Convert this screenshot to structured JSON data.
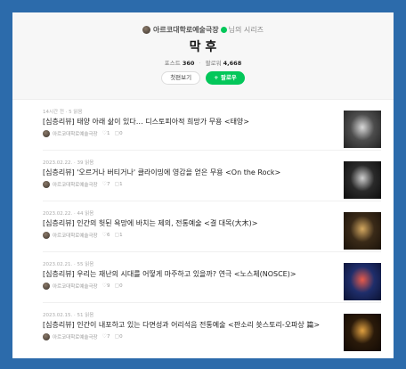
{
  "header": {
    "channel_name": "아르코대학로예술극장",
    "series_suffix": "님의 시리즈",
    "series_title": "막 후",
    "posts_label": "포스트",
    "posts_count": "360",
    "followers_label": "팔로워",
    "followers_count": "4,668",
    "first_view_label": "첫편보기",
    "follow_label": "+ 팔로우"
  },
  "items": [
    {
      "meta": "14시간 전 · 5 읽음",
      "title": "[심층리뷰] 태양 아래 삶이 있다… 디스토피아적 희망가 무용 <태양>",
      "author": "아르코대학로예술극장",
      "likes": "1",
      "comments": "0",
      "thumb_colors": [
        "#4d4d4d",
        "#d9d9d9",
        "#222222"
      ]
    },
    {
      "meta": "2023.02.22. · 39 읽음",
      "title": "[심층리뷰] '오르거나 버티거나' 클라이밍에 영감을 얻은 무용 <On the Rock>",
      "author": "아르코대학로예술극장",
      "likes": "7",
      "comments": "1",
      "thumb_colors": [
        "#2a2a2a",
        "#cfcfcf",
        "#0d0d0d"
      ]
    },
    {
      "meta": "2023.02.22. · 44 읽음",
      "title": "[심층리뷰] 인간의 헛된 욕망에 바치는 제의, 전통예술 <결 대목(大木)>",
      "author": "아르코대학로예술극장",
      "likes": "6",
      "comments": "1",
      "thumb_colors": [
        "#3a2a18",
        "#d4a860",
        "#1a120a"
      ]
    },
    {
      "meta": "2023.02.21. · 55 읽음",
      "title": "[심층리뷰] 우리는 재난의 시대를 어떻게 마주하고 있을까? 연극 <노스체(NOSCE)>",
      "author": "아르코대학로예술극장",
      "likes": "9",
      "comments": "0",
      "thumb_colors": [
        "#1f2e6b",
        "#e85a4a",
        "#0b1233"
      ]
    },
    {
      "meta": "2023.02.15. · 51 읽음",
      "title": "[심층리뷰] 인간이 내포하고 있는 다면성과 어리석음 전통예술 <판소리 쑛스토리-오파상 篇>",
      "author": "아르코대학로예술극장",
      "likes": "7",
      "comments": "0",
      "thumb_colors": [
        "#2a1a0a",
        "#e0a040",
        "#120a04"
      ]
    }
  ],
  "colors": {
    "background": "#2c6bab",
    "follow_green": "#03c75a"
  },
  "icons": {
    "like": "heart-icon",
    "comment": "comment-icon"
  }
}
